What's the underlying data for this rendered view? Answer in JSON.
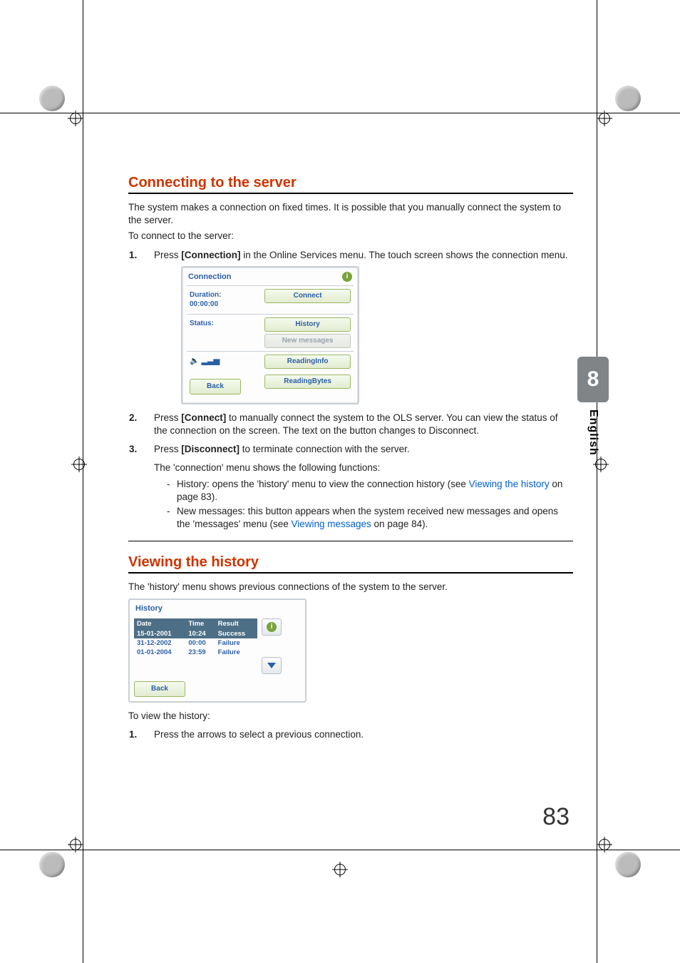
{
  "side_tab": {
    "number": "8",
    "lang": "English"
  },
  "page_number": "83",
  "section1": {
    "heading": "Connecting to the server",
    "intro1": "The system makes a connection on fixed times. It is possible that you manually connect the system to the server.",
    "intro2": "To connect to the server:",
    "step1_a": "Press ",
    "step1_b": "[Connection]",
    "step1_c": " in the Online Services menu. The touch screen shows the connection menu.",
    "step2_a": "Press ",
    "step2_b": "[Connect]",
    "step2_c": " to manually connect the system to the OLS server. You can view the status of the connection on the screen. The text on the button changes to Disconnect.",
    "step3_a": "Press ",
    "step3_b": "[Disconnect]",
    "step3_c": " to terminate connection with the server.",
    "sub_intro": "The 'connection' menu shows the following functions:",
    "bullet1_a": "History: opens the 'history' menu to view the connection history (see ",
    "bullet1_link": "Viewing the history",
    "bullet1_b": " on page 83).",
    "bullet2_a": "New messages: this button appears when the system received new messages and opens the 'messages' menu (see ",
    "bullet2_link": "Viewing messages",
    "bullet2_b": " on page 84)."
  },
  "conn_ui": {
    "title": "Connection",
    "duration_label": "Duration:",
    "duration_value": "00:00:00",
    "status_label": "Status:",
    "btn_connect": "Connect",
    "btn_history": "History",
    "btn_newmsg": "New messages",
    "btn_readinfo": "ReadingInfo",
    "btn_readbytes": "ReadingBytes",
    "btn_back": "Back"
  },
  "section2": {
    "heading": "Viewing the history",
    "intro": "The 'history' menu shows previous connections of the system to the server.",
    "outro": "To view the history:",
    "step1": "Press the arrows to select a previous connection."
  },
  "hist_ui": {
    "title": "History",
    "cols": {
      "date": "Date",
      "time": "Time",
      "result": "Result"
    },
    "rows": [
      {
        "date": "15-01-2001",
        "time": "10:24",
        "result": "Success"
      },
      {
        "date": "31-12-2002",
        "time": "00:00",
        "result": "Failure"
      },
      {
        "date": "01-01-2004",
        "time": "23:59",
        "result": "Failure"
      }
    ],
    "back": "Back"
  }
}
